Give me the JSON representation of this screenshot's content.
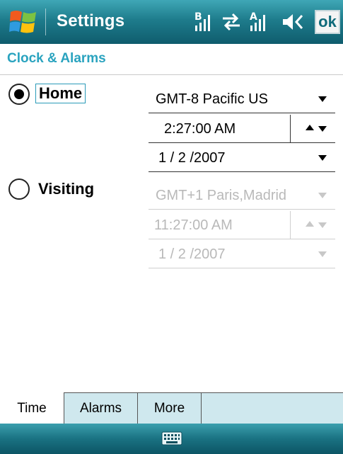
{
  "titlebar": {
    "title": "Settings",
    "ok_label": "ok",
    "start_icon": "windows-flag-icon",
    "status_icons": [
      "data-signal-icon",
      "connectivity-icon",
      "phone-signal-icon",
      "volume-icon"
    ],
    "data_signal_letter": "B",
    "phone_signal_letter": "A"
  },
  "page": {
    "heading": "Clock & Alarms"
  },
  "home": {
    "label": "Home",
    "selected": true,
    "timezone": "GMT-8 Pacific US",
    "time": "2:27:00 AM",
    "date": "1 / 2 /2007"
  },
  "visiting": {
    "label": "Visiting",
    "selected": false,
    "timezone": "GMT+1 Paris,Madrid",
    "time": "11:27:00 AM",
    "date": "1 / 2 /2007"
  },
  "tabs": [
    {
      "label": "Time",
      "active": true
    },
    {
      "label": "Alarms",
      "active": false
    },
    {
      "label": "More",
      "active": false
    }
  ],
  "menubar": {
    "icon": "keyboard-icon"
  },
  "colors": {
    "titlebar": "#1e7c8c",
    "heading": "#2aa3bf",
    "tabstrip": "#cfe8ee",
    "disabled_text": "#b9b9b9"
  }
}
